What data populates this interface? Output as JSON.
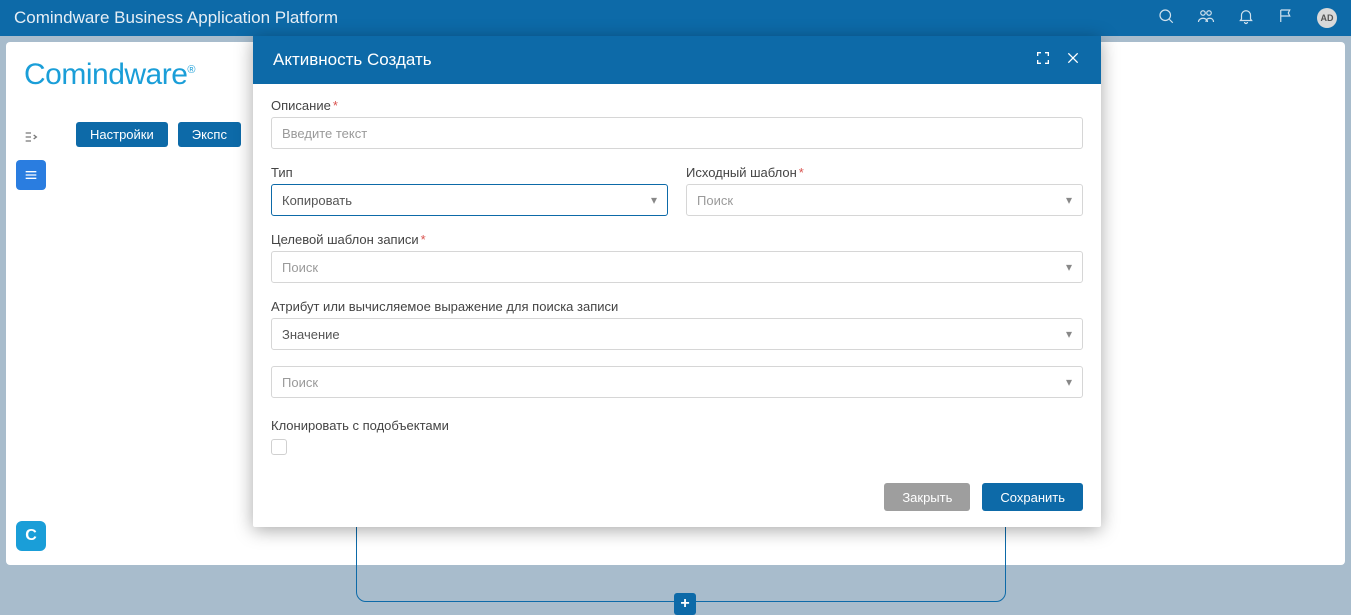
{
  "topbar": {
    "title": "Comindware Business Application Platform",
    "avatar_initials": "AD"
  },
  "brand": "Comindware",
  "brand_mark": "®",
  "pills": [
    "Настройки",
    "Экспс"
  ],
  "bottom_logo": "C",
  "modal": {
    "title": "Активность Создать",
    "fields": {
      "description": {
        "label": "Описание",
        "placeholder": "Введите текст"
      },
      "type": {
        "label": "Тип",
        "value": "Копировать"
      },
      "source_template": {
        "label": "Исходный шаблон",
        "placeholder": "Поиск"
      },
      "target_template": {
        "label": "Целевой шаблон записи",
        "placeholder": "Поиск"
      },
      "attr_expr": {
        "label": "Атрибут или вычисляемое выражение для поиска записи",
        "value": "Значение"
      },
      "search2": {
        "placeholder": "Поиск"
      },
      "clone": {
        "label": "Клонировать с подобъектами"
      }
    },
    "buttons": {
      "close": "Закрыть",
      "save": "Сохранить"
    }
  }
}
